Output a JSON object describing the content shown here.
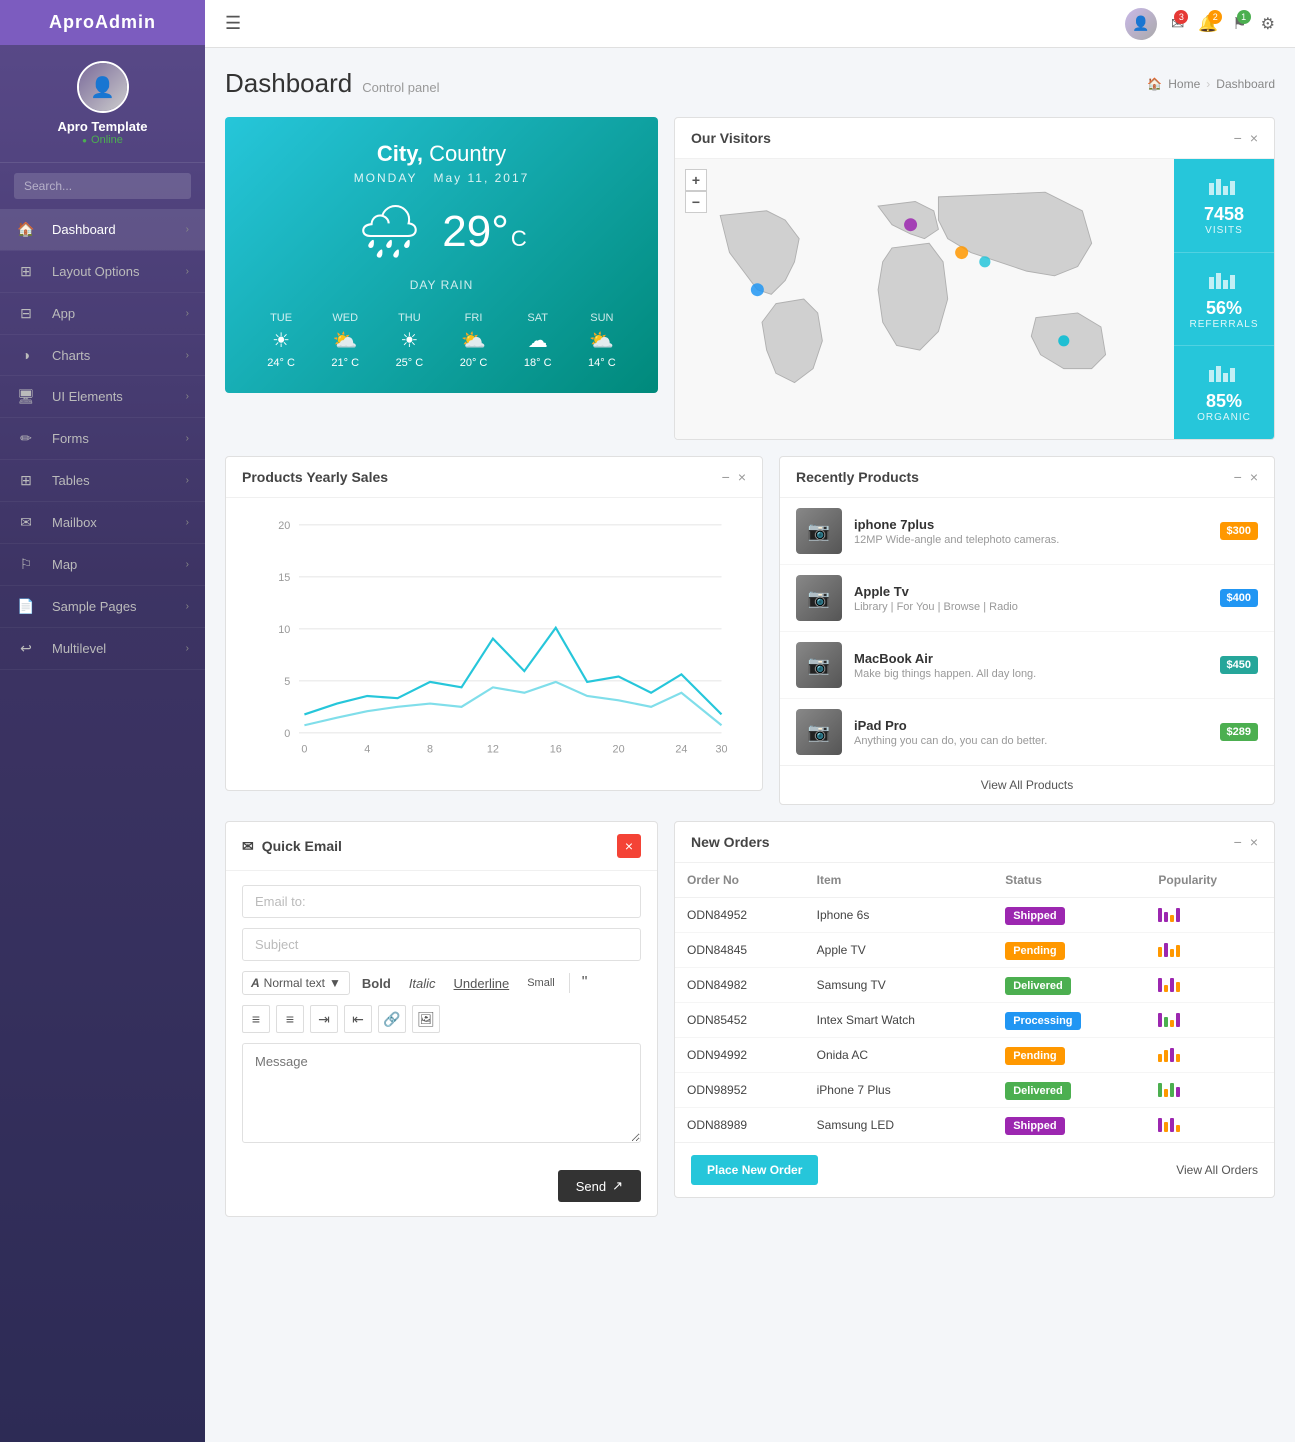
{
  "app": {
    "name": "AproAdmin"
  },
  "sidebar": {
    "profile": {
      "name": "Apro Template",
      "status": "Online"
    },
    "search_placeholder": "Search...",
    "nav_items": [
      {
        "id": "dashboard",
        "label": "Dashboard",
        "icon": "🏠",
        "active": true
      },
      {
        "id": "layout",
        "label": "Layout Options",
        "icon": "⊞"
      },
      {
        "id": "app",
        "label": "App",
        "icon": "⊟"
      },
      {
        "id": "charts",
        "label": "Charts",
        "icon": "◑"
      },
      {
        "id": "ui",
        "label": "UI Elements",
        "icon": "🖥"
      },
      {
        "id": "forms",
        "label": "Forms",
        "icon": "✏"
      },
      {
        "id": "tables",
        "label": "Tables",
        "icon": "⊞"
      },
      {
        "id": "mailbox",
        "label": "Mailbox",
        "icon": "✉"
      },
      {
        "id": "map",
        "label": "Map",
        "icon": "⚐"
      },
      {
        "id": "sample",
        "label": "Sample Pages",
        "icon": "📄"
      },
      {
        "id": "multilevel",
        "label": "Multilevel",
        "icon": "↩"
      }
    ]
  },
  "topbar": {
    "hamburger": "☰"
  },
  "header": {
    "title": "Dashboard",
    "subtitle": "Control panel",
    "breadcrumb": [
      "Home",
      "Dashboard"
    ]
  },
  "weather": {
    "city": "City,",
    "country": "Country",
    "date_day": "MONDAY",
    "date": "May 11, 2017",
    "temp": "29°",
    "unit": "C",
    "description": "DAY RAIN",
    "forecast": [
      {
        "day": "TUE",
        "icon": "☀",
        "temp": "24° C"
      },
      {
        "day": "WED",
        "icon": "⛅",
        "temp": "21° C"
      },
      {
        "day": "THU",
        "icon": "☀",
        "temp": "25° C"
      },
      {
        "day": "FRI",
        "icon": "⛅",
        "temp": "20° C"
      },
      {
        "day": "SAT",
        "icon": "☁",
        "temp": "18° C"
      },
      {
        "day": "SUN",
        "icon": "⛅",
        "temp": "14° C"
      }
    ]
  },
  "visitors": {
    "title": "Our Visitors",
    "stats": [
      {
        "value": "7458",
        "label": "VISITS"
      },
      {
        "value": "56%",
        "label": "REFERRALS"
      },
      {
        "value": "85%",
        "label": "ORGANIC"
      }
    ]
  },
  "sales_chart": {
    "title": "Products Yearly Sales",
    "y_axis": [
      20,
      15,
      10,
      5,
      0
    ],
    "x_axis": [
      0,
      4,
      8,
      12,
      16,
      20,
      24,
      30
    ]
  },
  "recently_products": {
    "title": "Recently Products",
    "products": [
      {
        "name": "iphone 7plus",
        "desc": "12MP Wide-angle and telephoto cameras.",
        "price": "$300",
        "price_class": "price-orange"
      },
      {
        "name": "Apple Tv",
        "desc": "Library | For You | Browse | Radio",
        "price": "$400",
        "price_class": "price-blue"
      },
      {
        "name": "MacBook Air",
        "desc": "Make big things happen. All day long.",
        "price": "$450",
        "price_class": "price-teal"
      },
      {
        "name": "iPad Pro",
        "desc": "Anything you can do, you can do better.",
        "price": "$289",
        "price_class": "price-green"
      }
    ],
    "view_all": "View All Products"
  },
  "quick_email": {
    "title": "Quick Email",
    "email_to_placeholder": "Email to:",
    "subject_placeholder": "Subject",
    "normal_text_label": "Normal text",
    "bold_label": "Bold",
    "italic_label": "Italic",
    "underline_label": "Underline",
    "small_label": "Small",
    "message_placeholder": "Message",
    "send_label": "Send"
  },
  "new_orders": {
    "title": "New Orders",
    "columns": [
      "Order No",
      "Item",
      "Status",
      "Popularity"
    ],
    "orders": [
      {
        "id": "ODN84952",
        "item": "Iphone 6s",
        "status": "Shipped",
        "status_class": "status-shipped",
        "pop_colors": [
          "#9c27b0",
          "#9c27b0",
          "#ff9800",
          "#9c27b0"
        ],
        "pop_heights": [
          14,
          10,
          7,
          14
        ]
      },
      {
        "id": "ODN84845",
        "item": "Apple TV",
        "status": "Pending",
        "status_class": "status-pending",
        "pop_colors": [
          "#ff9800",
          "#9c27b0",
          "#ff9800",
          "#ff9800"
        ],
        "pop_heights": [
          10,
          14,
          8,
          12
        ]
      },
      {
        "id": "ODN84982",
        "item": "Samsung TV",
        "status": "Delivered",
        "status_class": "status-delivered",
        "pop_colors": [
          "#9c27b0",
          "#ff9800",
          "#9c27b0",
          "#ff9800"
        ],
        "pop_heights": [
          14,
          7,
          14,
          10
        ]
      },
      {
        "id": "ODN85452",
        "item": "Intex Smart Watch",
        "status": "Processing",
        "status_class": "status-processing",
        "pop_colors": [
          "#9c27b0",
          "#4caf50",
          "#ff9800",
          "#9c27b0"
        ],
        "pop_heights": [
          14,
          10,
          7,
          14
        ]
      },
      {
        "id": "ODN94992",
        "item": "Onida AC",
        "status": "Pending",
        "status_class": "status-pending",
        "pop_colors": [
          "#ff9800",
          "#ff9800",
          "#9c27b0",
          "#ff9800"
        ],
        "pop_heights": [
          8,
          12,
          14,
          8
        ]
      },
      {
        "id": "ODN98952",
        "item": "iPhone 7 Plus",
        "status": "Delivered",
        "status_class": "status-delivered",
        "pop_colors": [
          "#4caf50",
          "#ff9800",
          "#4caf50",
          "#9c27b0"
        ],
        "pop_heights": [
          14,
          8,
          14,
          10
        ]
      },
      {
        "id": "ODN88989",
        "item": "Samsung LED",
        "status": "Shipped",
        "status_class": "status-shipped",
        "pop_colors": [
          "#9c27b0",
          "#ff9800",
          "#9c27b0",
          "#ff9800"
        ],
        "pop_heights": [
          14,
          10,
          14,
          7
        ]
      }
    ],
    "place_order": "Place New Order",
    "view_all": "View All Orders"
  }
}
